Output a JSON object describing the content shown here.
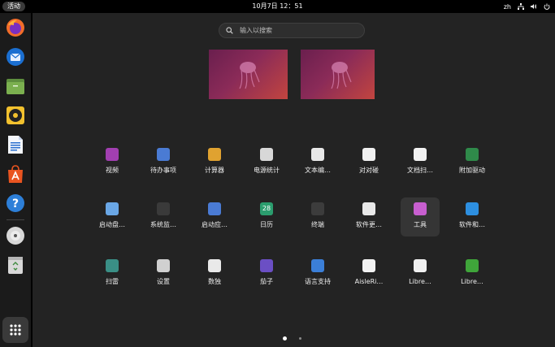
{
  "topbar": {
    "activities_label": "活动",
    "clock": "10月7日  12：51",
    "input_method": "zh",
    "icons": [
      "network-icon",
      "volume-icon",
      "power-icon"
    ]
  },
  "dock": {
    "items": [
      "firefox-icon",
      "thunderbird-icon",
      "files-icon",
      "rhythmbox-icon",
      "libreoffice-writer-icon",
      "ubuntu-software-icon",
      "help-icon",
      "disc-icon",
      "trash-icon"
    ],
    "show_apps_icon": "app-grid-icon"
  },
  "search": {
    "placeholder": "输入以搜索"
  },
  "apps": [
    {
      "label": "视频",
      "icon": "video-icon",
      "color": "#a23fb1"
    },
    {
      "label": "待办事项",
      "icon": "todo-icon",
      "color": "#4a7bd4"
    },
    {
      "label": "计算器",
      "icon": "calculator-icon",
      "color": "#e0a230"
    },
    {
      "label": "电源统计",
      "icon": "power-statistics-icon",
      "color": "#d8d8d8"
    },
    {
      "label": "文本编…",
      "icon": "text-editor-icon",
      "color": "#e8e8e8"
    },
    {
      "label": "对对碰",
      "icon": "mahjongg-icon",
      "color": "#f0f0f0"
    },
    {
      "label": "文档扫…",
      "icon": "document-scanner-icon",
      "color": "#f2f2f2"
    },
    {
      "label": "附加驱动",
      "icon": "additional-drivers-icon",
      "color": "#2f8a4a"
    },
    {
      "label": "启动盘…",
      "icon": "startup-disk-icon",
      "color": "#6aa7e6"
    },
    {
      "label": "系统监…",
      "icon": "system-monitor-icon",
      "color": "#3a3a3a"
    },
    {
      "label": "启动应…",
      "icon": "startup-apps-icon",
      "color": "#4a7bd4"
    },
    {
      "label": "日历",
      "icon": "calendar-icon",
      "color": "#2b9d6e",
      "text": "28"
    },
    {
      "label": "终端",
      "icon": "terminal-icon",
      "color": "#3c3c3c"
    },
    {
      "label": "软件更…",
      "icon": "software-updater-icon",
      "color": "#e8e8e8"
    },
    {
      "label": "工具",
      "icon": "utilities-folder-icon",
      "color": "#c85fd0"
    },
    {
      "label": "软件和…",
      "icon": "software-properties-icon",
      "color": "#2d8fe0"
    },
    {
      "label": "扫雷",
      "icon": "mines-icon",
      "color": "#3a8f86"
    },
    {
      "label": "设置",
      "icon": "settings-icon",
      "color": "#d0d0d0"
    },
    {
      "label": "数独",
      "icon": "sudoku-icon",
      "color": "#e9e9e9"
    },
    {
      "label": "茄子",
      "icon": "cheese-icon",
      "color": "#6b4fc4"
    },
    {
      "label": "语言支持",
      "icon": "language-support-icon",
      "color": "#3b7fd8"
    },
    {
      "label": "AisleRi…",
      "icon": "aisleriot-icon",
      "color": "#f2f2f2"
    },
    {
      "label": "Libre…",
      "icon": "libreoffice-icon",
      "color": "#f0f0f0"
    },
    {
      "label": "Libre…",
      "icon": "libreoffice-calc-icon",
      "color": "#3fa53a"
    }
  ],
  "pagination": {
    "current": 1,
    "total": 2
  }
}
